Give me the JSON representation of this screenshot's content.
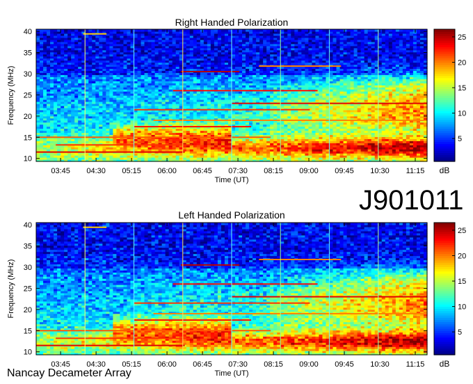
{
  "figure": {
    "observation_id": "J901011",
    "observatory": "Nancay Decameter Array"
  },
  "chart_data": [
    {
      "type": "heatmap",
      "title": "Right Handed Polarization",
      "xlabel": "Time (UT)",
      "ylabel": "Frequency (MHz)",
      "x_ticks": [
        "03:45",
        "04:30",
        "05:15",
        "06:00",
        "06:45",
        "07:30",
        "08:15",
        "09:00",
        "09:45",
        "10:30",
        "11:15"
      ],
      "y_ticks": [
        10,
        15,
        20,
        25,
        30,
        35,
        40
      ],
      "xlim": [
        "03:14",
        "11:30"
      ],
      "ylim": [
        9.3,
        40.5
      ],
      "colorbar": {
        "label": "dB",
        "ticks": [
          5,
          10,
          15,
          20,
          25
        ],
        "range": [
          0.5,
          26.5
        ],
        "colormap": "jet"
      }
    },
    {
      "type": "heatmap",
      "title": "Left Handed Polarization",
      "xlabel": "Time (UT)",
      "ylabel": "Frequency (MHz)",
      "x_ticks": [
        "03:45",
        "04:30",
        "05:15",
        "06:00",
        "06:45",
        "07:30",
        "08:15",
        "09:00",
        "09:45",
        "10:30",
        "11:15"
      ],
      "y_ticks": [
        10,
        15,
        20,
        25,
        30,
        35,
        40
      ],
      "xlim": [
        "03:14",
        "11:30"
      ],
      "ylim": [
        9.3,
        40.5
      ],
      "colorbar": {
        "label": "dB",
        "ticks": [
          5,
          10,
          15,
          20,
          25
        ],
        "range": [
          0.5,
          26.5
        ],
        "colormap": "jet"
      }
    }
  ]
}
